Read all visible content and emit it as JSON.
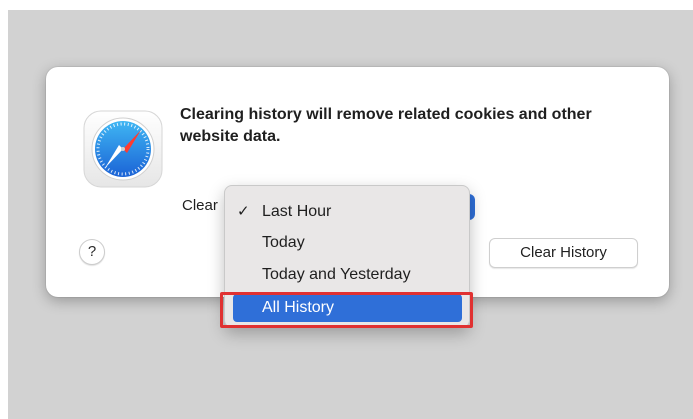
{
  "dialog": {
    "message": "Clearing history will remove related cookies and other website data.",
    "clear_label": "Clear",
    "help_label": "?",
    "clear_history_label": "Clear History",
    "app_icon": "safari-compass-icon"
  },
  "menu": {
    "selected": "Last Hour",
    "highlighted": "All History",
    "checkmark": "✓",
    "items": [
      {
        "label": "Last Hour"
      },
      {
        "label": "Today"
      },
      {
        "label": "Today and Yesterday"
      },
      {
        "label": "All History"
      }
    ]
  },
  "colors": {
    "accent": "#2f6fd8",
    "annotation": "#e03131"
  }
}
